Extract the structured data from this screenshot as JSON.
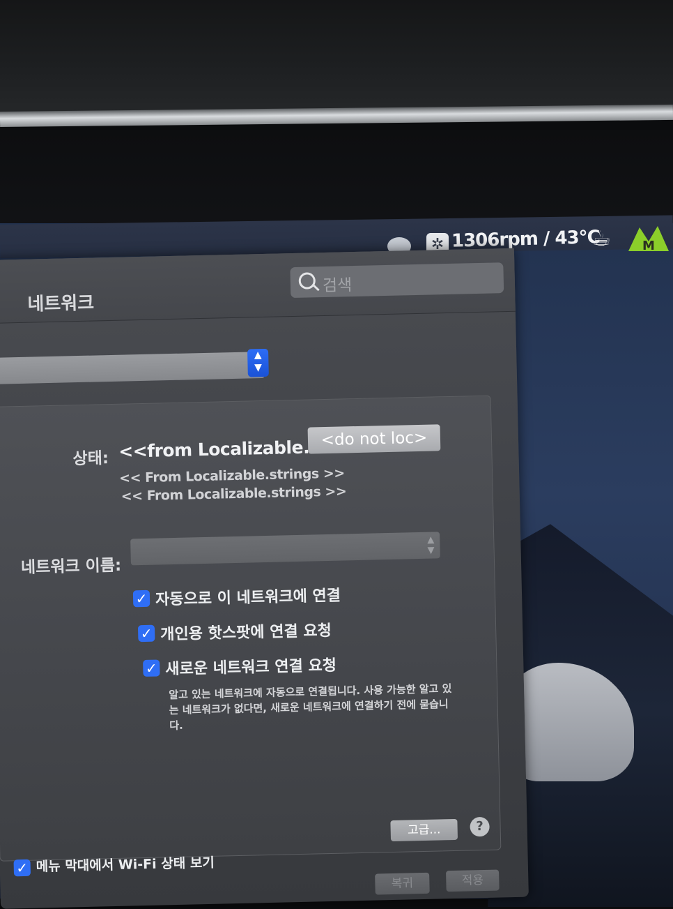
{
  "menubar": {
    "fan_readout": "1306rpm / 43°C",
    "icons": [
      "chat-bubble-icon",
      "fan-icon",
      "coffee-cup-icon",
      "mountain-m-icon"
    ]
  },
  "window": {
    "title": "네트워크",
    "search_placeholder": "검색"
  },
  "status": {
    "label": "상태:",
    "value": "<<from Localizable...",
    "toggle_button": "<do not loc>",
    "lines": [
      "<< From Localizable.strings >>",
      "<< From Localizable.strings >>"
    ]
  },
  "network_name": {
    "label": "네트워크 이름:",
    "value": ""
  },
  "options": {
    "auto_connect": "자동으로 이 네트워크에 연결",
    "hotspot": "개인용 핫스팟에 연결 요청",
    "ask_new": "새로운 네트워크 연결 요청",
    "help_text": "알고 있는 네트워크에 자동으로 연결됩니다. 사용 가능한 알고 있는 네트워크가 없다면, 새로운 네트워크에 연결하기 전에 묻습니다."
  },
  "footer": {
    "advanced_button": "고급...",
    "help_button": "?",
    "show_wifi_status": "메뉴 막대에서 Wi-Fi 상태 보기",
    "revert_button": "복귀",
    "apply_button": "적용"
  },
  "colors": {
    "accent": "#2f6ef5",
    "window_bg": "#45474c",
    "desktop": "#2b3d5f"
  }
}
